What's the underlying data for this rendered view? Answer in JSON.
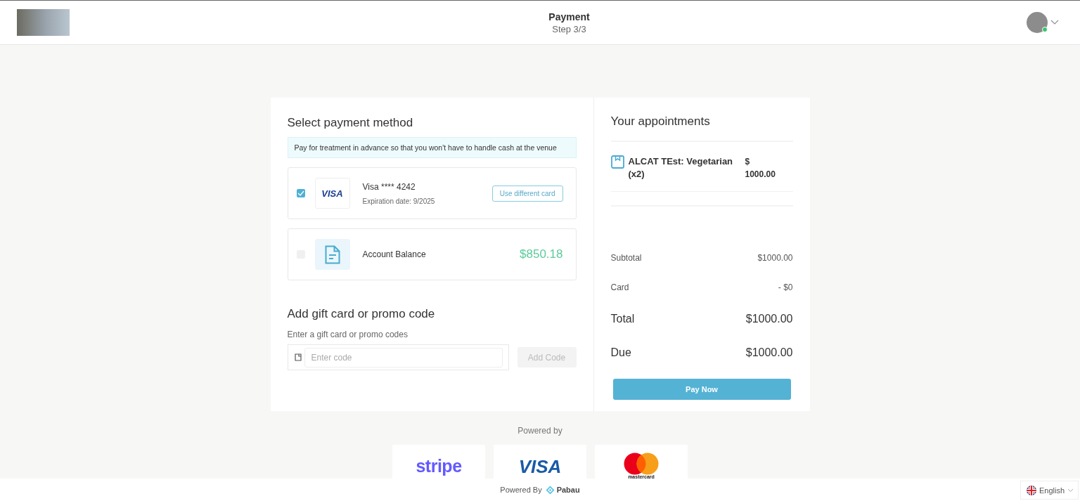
{
  "header": {
    "title": "Payment",
    "step": "Step 3/3",
    "user": {
      "online": true
    }
  },
  "payment": {
    "title": "Select payment method",
    "notice": "Pay for treatment in advance so that you won't have to handle cash at the venue",
    "methods": [
      {
        "kind": "card",
        "selected": true,
        "brand": "VISA",
        "name": "Visa **** 4242",
        "detail": "Expiration date: 9/2025",
        "action": "Use different card"
      },
      {
        "kind": "balance",
        "selected": false,
        "name": "Account Balance",
        "amount": "$850.18"
      }
    ]
  },
  "promo": {
    "title": "Add gift card or promo code",
    "label": "Enter a gift card or promo codes",
    "placeholder": "Enter code",
    "button": "Add Code",
    "button_disabled": true
  },
  "summary": {
    "title": "Your appointments",
    "items": [
      {
        "name": "ALCAT TEst: Vegetarian (x2)",
        "currency": "$",
        "price": "1000.00"
      }
    ],
    "lines": [
      {
        "kind": "minor",
        "label": "Subtotal",
        "value": "$1000.00"
      },
      {
        "kind": "minor",
        "label": "Card",
        "value": "- $0"
      },
      {
        "kind": "major",
        "label": "Total",
        "value": "$1000.00"
      },
      {
        "kind": "major",
        "label": "Due",
        "value": "$1000.00"
      }
    ],
    "pay_button": "Pay Now"
  },
  "powered": {
    "label": "Powered by",
    "logos": [
      {
        "kind": "stripe",
        "text": "stripe"
      },
      {
        "kind": "visa",
        "text": "VISA"
      },
      {
        "kind": "mastercard",
        "text": "mastercard"
      }
    ]
  },
  "footer": {
    "label": "Powered By",
    "brand": "Pabau",
    "language": "English"
  }
}
